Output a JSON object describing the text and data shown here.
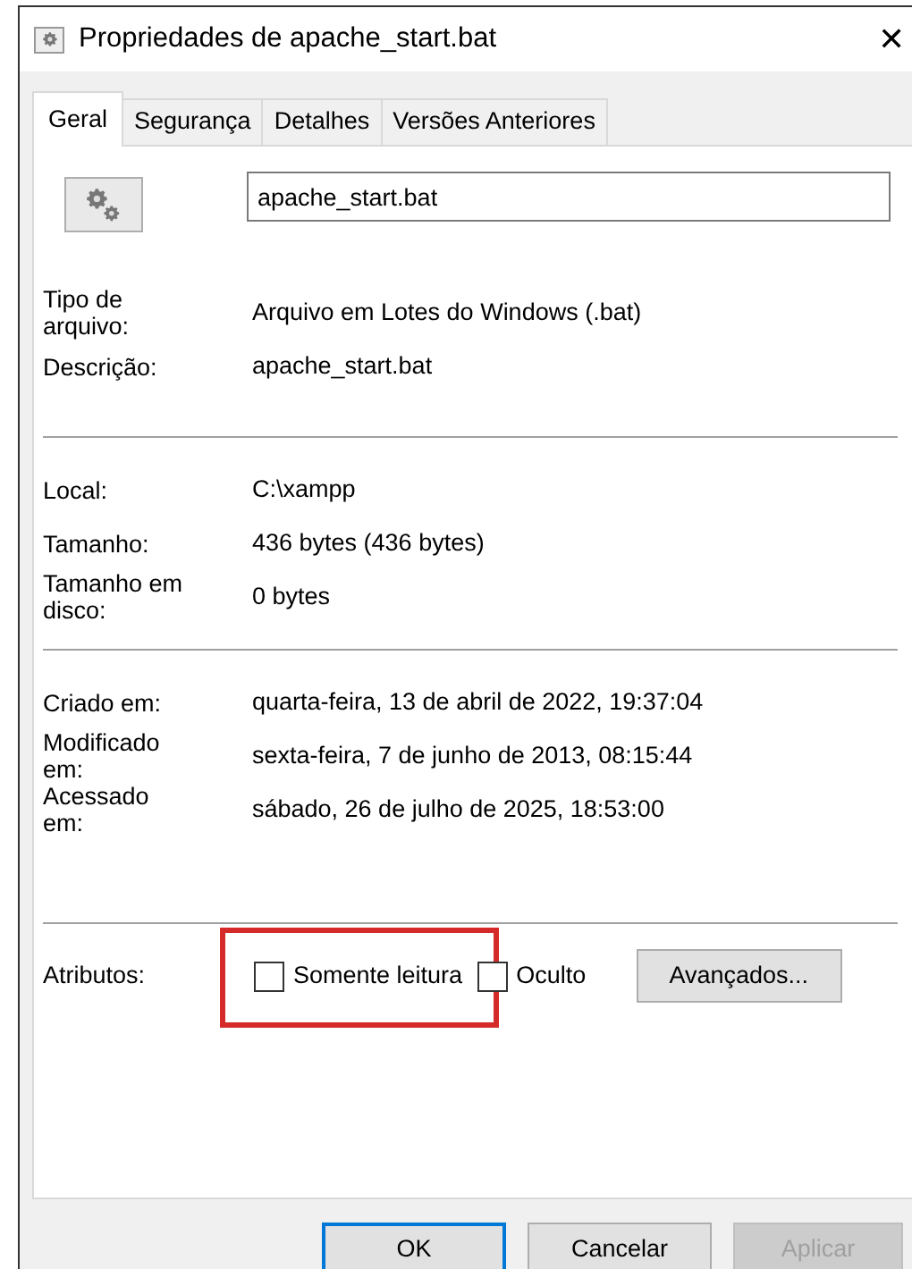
{
  "window": {
    "title": "Propriedades de apache_start.bat",
    "close": "✕"
  },
  "tabs": [
    {
      "label": "Geral",
      "selected": true
    },
    {
      "label": "Segurança",
      "selected": false
    },
    {
      "label": "Detalhes",
      "selected": false
    },
    {
      "label": "Versões Anteriores",
      "selected": false
    }
  ],
  "file_name": {
    "value": "apache_start.bat"
  },
  "groups": [
    [
      {
        "label": "Tipo de arquivo:",
        "value": "Arquivo em Lotes do Windows (.bat)"
      },
      {
        "label": "Descrição:",
        "value": "apache_start.bat"
      }
    ],
    [
      {
        "label": "Local:",
        "value": "C:\\xampp"
      },
      {
        "label": "Tamanho:",
        "value": "436 bytes (436 bytes)"
      },
      {
        "label": "Tamanho em disco:",
        "value": "0 bytes"
      }
    ],
    [
      {
        "label": "Criado em:",
        "value": "quarta-feira, 13 de abril de 2022, 19:37:04"
      },
      {
        "label": "Modificado em:",
        "value": "sexta-feira, 7 de junho de 2013, 08:15:44"
      },
      {
        "label": "Acessado em:",
        "value": "sábado, 26 de julho de 2025, 18:53:00"
      }
    ]
  ],
  "attributes": {
    "label": "Atributos:",
    "options": [
      {
        "label": "Somente leitura",
        "checked": false,
        "highlighted": true
      },
      {
        "label": "Oculto",
        "checked": false,
        "highlighted": false
      }
    ],
    "advanced_button": "Avançados..."
  },
  "buttons": [
    {
      "label": "OK",
      "default": true,
      "disabled": false
    },
    {
      "label": "Cancelar",
      "default": false,
      "disabled": false
    },
    {
      "label": "Aplicar",
      "default": false,
      "disabled": true
    }
  ]
}
